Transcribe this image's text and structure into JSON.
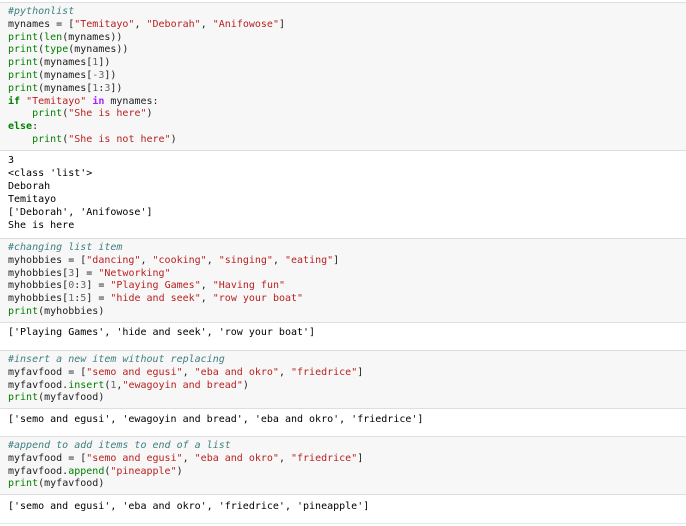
{
  "cells": [
    {
      "code": [
        [
          [
            "c",
            "#pythonlist"
          ]
        ],
        [
          [
            "p",
            "mynames = ["
          ],
          [
            "s",
            "\"Temitayo\""
          ],
          [
            "p",
            ", "
          ],
          [
            "s",
            "\"Deborah\""
          ],
          [
            "p",
            ", "
          ],
          [
            "s",
            "\"Anifowose\""
          ],
          [
            "p",
            "]"
          ]
        ],
        [
          [
            "b",
            "print"
          ],
          [
            "p",
            "("
          ],
          [
            "b",
            "len"
          ],
          [
            "p",
            "(mynames))"
          ]
        ],
        [
          [
            "b",
            "print"
          ],
          [
            "p",
            "("
          ],
          [
            "b",
            "type"
          ],
          [
            "p",
            "(mynames))"
          ]
        ],
        [
          [
            "b",
            "print"
          ],
          [
            "p",
            "(mynames["
          ],
          [
            "m",
            "1"
          ],
          [
            "p",
            "])"
          ]
        ],
        [
          [
            "b",
            "print"
          ],
          [
            "p",
            "(mynames["
          ],
          [
            "m",
            "-3"
          ],
          [
            "p",
            "])"
          ]
        ],
        [
          [
            "b",
            "print"
          ],
          [
            "p",
            "(mynames["
          ],
          [
            "m",
            "1"
          ],
          [
            "p",
            ":"
          ],
          [
            "m",
            "3"
          ],
          [
            "p",
            "])"
          ]
        ],
        [
          [
            "k",
            "if"
          ],
          [
            "p",
            " "
          ],
          [
            "s",
            "\"Temitayo\""
          ],
          [
            "p",
            " "
          ],
          [
            "o",
            "in"
          ],
          [
            "p",
            " mynames:"
          ]
        ],
        [
          [
            "p",
            "    "
          ],
          [
            "b",
            "print"
          ],
          [
            "p",
            "("
          ],
          [
            "s",
            "\"She is here\""
          ],
          [
            "p",
            ")"
          ]
        ],
        [
          [
            "k",
            "else"
          ],
          [
            "p",
            ":"
          ]
        ],
        [
          [
            "p",
            "    "
          ],
          [
            "b",
            "print"
          ],
          [
            "p",
            "("
          ],
          [
            "s",
            "\"She is not here\""
          ],
          [
            "p",
            ")"
          ]
        ]
      ],
      "output": [
        "3",
        "<class 'list'>",
        "Deborah",
        "Temitayo",
        "['Deborah', 'Anifowose']",
        "She is here"
      ]
    },
    {
      "code": [
        [
          [
            "c",
            "#changing list item"
          ]
        ],
        [
          [
            "p",
            "myhobbies = ["
          ],
          [
            "s",
            "\"dancing\""
          ],
          [
            "p",
            ", "
          ],
          [
            "s",
            "\"cooking\""
          ],
          [
            "p",
            ", "
          ],
          [
            "s",
            "\"singing\""
          ],
          [
            "p",
            ", "
          ],
          [
            "s",
            "\"eating\""
          ],
          [
            "p",
            "]"
          ]
        ],
        [
          [
            "p",
            "myhobbies["
          ],
          [
            "m",
            "3"
          ],
          [
            "p",
            "] = "
          ],
          [
            "s",
            "\"Networking\""
          ]
        ],
        [
          [
            "p",
            "myhobbies["
          ],
          [
            "m",
            "0"
          ],
          [
            "p",
            ":"
          ],
          [
            "m",
            "3"
          ],
          [
            "p",
            "] = "
          ],
          [
            "s",
            "\"Playing Games\""
          ],
          [
            "p",
            ", "
          ],
          [
            "s",
            "\"Having fun\""
          ]
        ],
        [
          [
            "p",
            "myhobbies["
          ],
          [
            "m",
            "1"
          ],
          [
            "p",
            ":"
          ],
          [
            "m",
            "5"
          ],
          [
            "p",
            "] = "
          ],
          [
            "s",
            "\"hide and seek\""
          ],
          [
            "p",
            ", "
          ],
          [
            "s",
            "\"row your boat\""
          ]
        ],
        [
          [
            "b",
            "print"
          ],
          [
            "p",
            "(myhobbies)"
          ]
        ]
      ],
      "output": [
        "['Playing Games', 'hide and seek', 'row your boat']"
      ]
    },
    {
      "code": [
        [
          [
            "c",
            "#insert a new item without replacing"
          ]
        ],
        [
          [
            "p",
            "myfavfood = ["
          ],
          [
            "s",
            "\"semo and egusi\""
          ],
          [
            "p",
            ", "
          ],
          [
            "s",
            "\"eba and okro\""
          ],
          [
            "p",
            ", "
          ],
          [
            "s",
            "\"friedrice\""
          ],
          [
            "p",
            "]"
          ]
        ],
        [
          [
            "p",
            "myfavfood."
          ],
          [
            "n",
            "insert"
          ],
          [
            "p",
            "("
          ],
          [
            "m",
            "1"
          ],
          [
            "p",
            ","
          ],
          [
            "s",
            "\"ewagoyin and bread\""
          ],
          [
            "p",
            ")"
          ]
        ],
        [
          [
            "b",
            "print"
          ],
          [
            "p",
            "(myfavfood)"
          ]
        ]
      ],
      "output": [
        "['semo and egusi', 'ewagoyin and bread', 'eba and okro', 'friedrice']"
      ]
    },
    {
      "code": [
        [
          [
            "c",
            "#append to add items to end of a list"
          ]
        ],
        [
          [
            "p",
            "myfavfood = ["
          ],
          [
            "s",
            "\"semo and egusi\""
          ],
          [
            "p",
            ", "
          ],
          [
            "s",
            "\"eba and okro\""
          ],
          [
            "p",
            ", "
          ],
          [
            "s",
            "\"friedrice\""
          ],
          [
            "p",
            "]"
          ]
        ],
        [
          [
            "p",
            "myfavfood."
          ],
          [
            "n",
            "append"
          ],
          [
            "p",
            "("
          ],
          [
            "s",
            "\"pineapple\""
          ],
          [
            "p",
            ")"
          ]
        ],
        [
          [
            "b",
            "print"
          ],
          [
            "p",
            "(myfavfood)"
          ]
        ]
      ],
      "output": [
        "['semo and egusi', 'eba and okro', 'friedrice', 'pineapple']"
      ]
    }
  ]
}
